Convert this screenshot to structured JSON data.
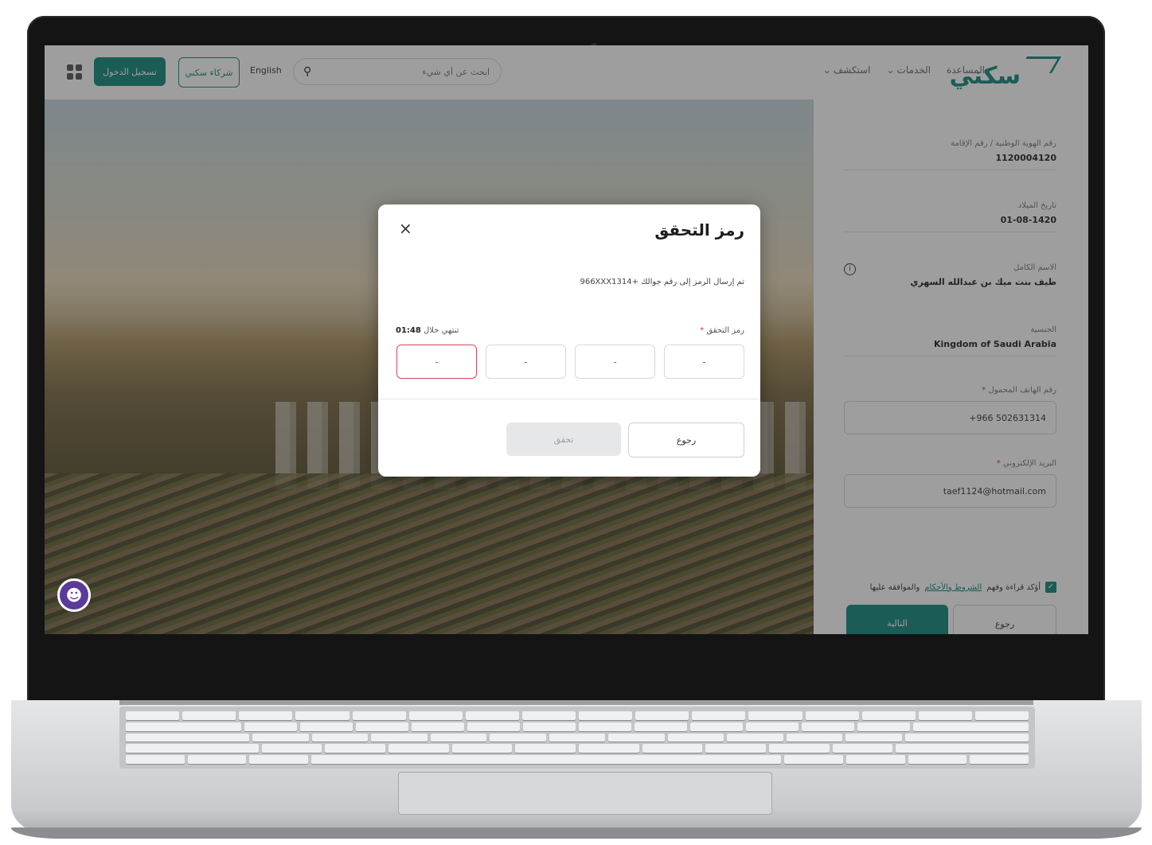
{
  "header": {
    "logo_text": "سكني",
    "nav": [
      "المساعدة",
      "الخدمات",
      "استكشف"
    ],
    "search_placeholder": "ابحث عن أي شيء",
    "language_link": "English",
    "partners_button": "شركاء سكني",
    "login_button": "تسجيل الدخول"
  },
  "form": {
    "id_label": "رقم الهوية الوطنية / رقم الإقامة",
    "id_value": "1120004120",
    "dob_label": "تاريخ الميلاد",
    "dob_value": "01-08-1420",
    "name_label": "الاسم الكامل",
    "name_value": "طيف بنت ميك بن عبدالله السهري",
    "nationality_label": "الجنسية",
    "nationality_value": "Kingdom of Saudi Arabia",
    "mobile_label": "رقم الهاتف المحمول",
    "mobile_value": "+966 502631314",
    "email_label": "البريد الإلكتروني",
    "email_value": "taef1124@hotmail.com",
    "terms_prefix": "أؤكد قراءة وفهم",
    "terms_link": "الشروط والأحكام",
    "terms_suffix": "والموافقة عليها",
    "back_button": "رجوع",
    "next_button": "التالية",
    "required_mark": "*"
  },
  "modal": {
    "title": "رمز التحقق",
    "close_symbol": "×",
    "message": "تم إرسال الرمز إلى رقم جوالك +966XXX1314",
    "otp_label": "رمز التحقق",
    "timer_prefix": "تنتهي خلال",
    "timer_value": "01:48",
    "otp_placeholder": "-",
    "verify_button": "تحقق",
    "back_button": "رجوع"
  },
  "colors": {
    "brand": "#12877f",
    "error": "#d44a55",
    "accessibility": "#5b3a9c"
  },
  "icons": [
    "apps-grid-icon",
    "search-icon",
    "chevron-down-icon",
    "info-icon",
    "close-icon",
    "accessibility-icon",
    "check-icon",
    "recaptcha-icon"
  ]
}
